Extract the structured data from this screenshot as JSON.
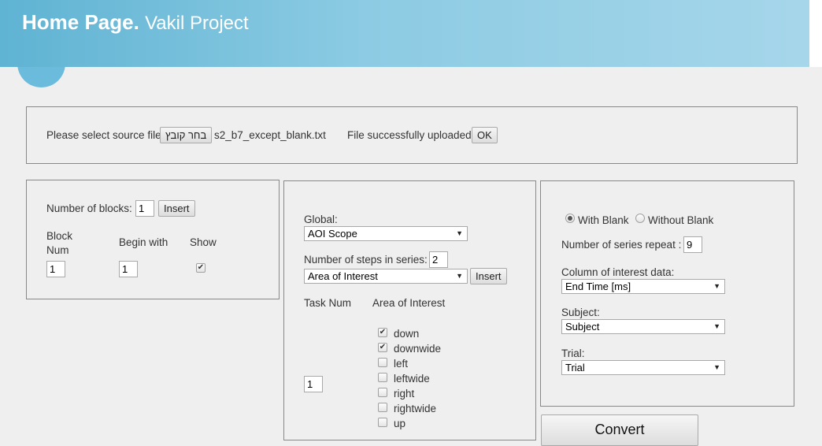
{
  "header": {
    "title_bold": "Home Page.",
    "title_sub": "Vakil Project"
  },
  "upload": {
    "select_label": "Please select source file",
    "choose_file_button": "בחר קובץ",
    "file_name": "s2_b7_except_blank.txt",
    "status": "File successfully uploaded",
    "ok_button": "OK"
  },
  "blocks": {
    "number_label": "Number of blocks:",
    "number_value": "1",
    "insert_button": "Insert",
    "col_block_num": "Block Num",
    "col_begin_with": "Begin with",
    "col_show": "Show",
    "row_block_num": "1",
    "row_begin_with": "1",
    "row_show_checked": true
  },
  "global": {
    "global_label": "Global:",
    "global_select": "AOI Scope",
    "steps_label": "Number of steps in series:",
    "steps_value": "2",
    "aoi_select": "Area of Interest",
    "insert_button": "Insert",
    "col_task_num": "Task Num",
    "col_aoi": "Area of Interest",
    "task_num_value": "1",
    "aoi_options": [
      {
        "label": "down",
        "checked": true
      },
      {
        "label": "downwide",
        "checked": true
      },
      {
        "label": "left",
        "checked": false
      },
      {
        "label": "leftwide",
        "checked": false
      },
      {
        "label": "right",
        "checked": false
      },
      {
        "label": "rightwide",
        "checked": false
      },
      {
        "label": "up",
        "checked": false
      }
    ]
  },
  "options": {
    "with_blank": "With Blank",
    "without_blank": "Without Blank",
    "with_blank_selected": true,
    "repeat_label": "Number of series repeat :",
    "repeat_value": "9",
    "column_label": "Column of interest data:",
    "column_select": "End Time [ms]",
    "subject_label": "Subject:",
    "subject_select": "Subject",
    "trial_label": "Trial:",
    "trial_select": "Trial"
  },
  "convert_button": "Convert"
}
